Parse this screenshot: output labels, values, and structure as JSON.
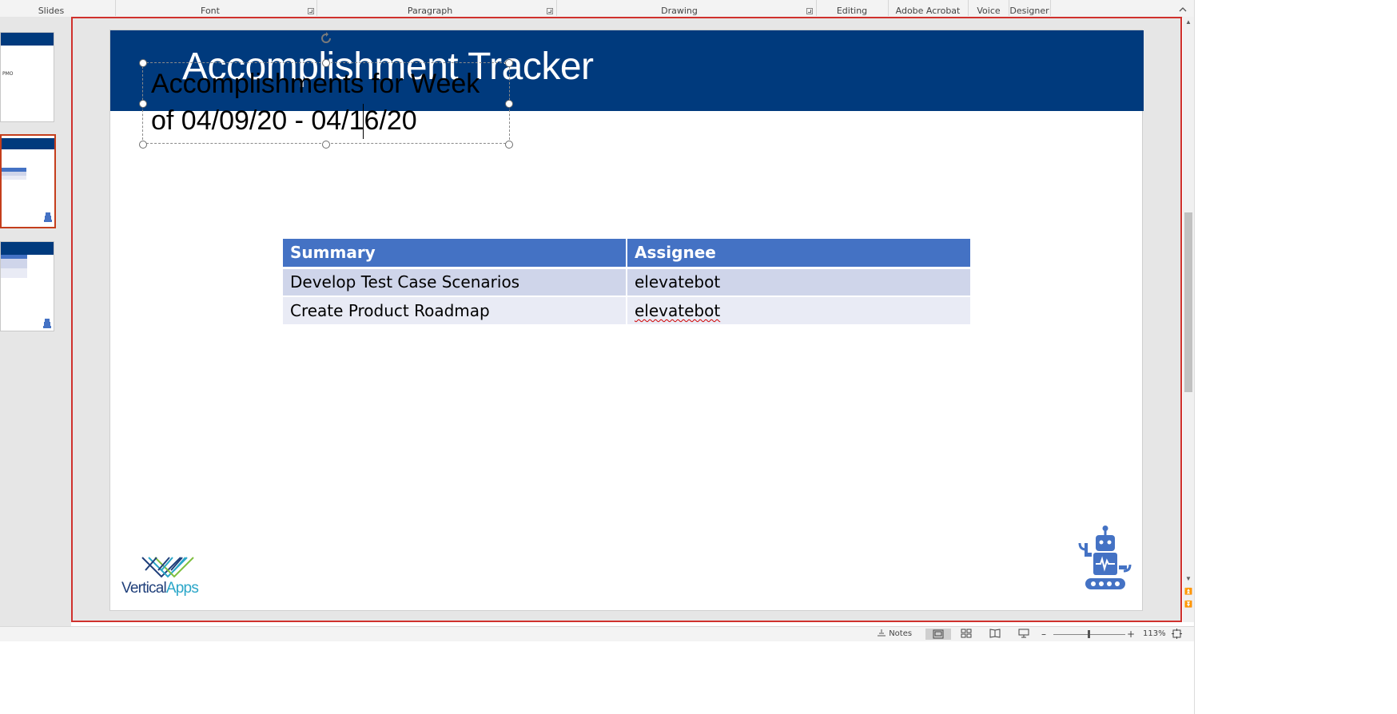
{
  "ribbon": {
    "groups": [
      "Slides",
      "Font",
      "Paragraph",
      "Drawing",
      "Editing",
      "Adobe Acrobat",
      "Voice",
      "Designer"
    ],
    "collapse_glyph": "^"
  },
  "thumbnails": {
    "slide1_text": "PMO"
  },
  "slide": {
    "title": "Accomplishment Tracker",
    "textbox_line1": "Accomplishments for Week",
    "textbox_line2": "of 04/09/20 - 04/16/20",
    "table": {
      "headers": [
        "Summary",
        "Assignee"
      ],
      "rows": [
        [
          "Develop Test Case Scenarios",
          "elevatebot"
        ],
        [
          "Create Product Roadmap",
          "elevatebot"
        ]
      ]
    },
    "logo": {
      "word1": "Vertical",
      "word2": "Apps",
      "word1_color": "#1f3f7a",
      "word2_color": "#2aa6c8"
    },
    "colors": {
      "header_band": "#003a7d",
      "table_header": "#4472c4",
      "row_odd": "#cfd5ea",
      "row_even": "#e9ebf5",
      "robot": "#4472c4"
    }
  },
  "statusbar": {
    "notes_label": "Notes",
    "zoom_minus": "–",
    "zoom_plus": "+",
    "zoom_level": "113%"
  }
}
